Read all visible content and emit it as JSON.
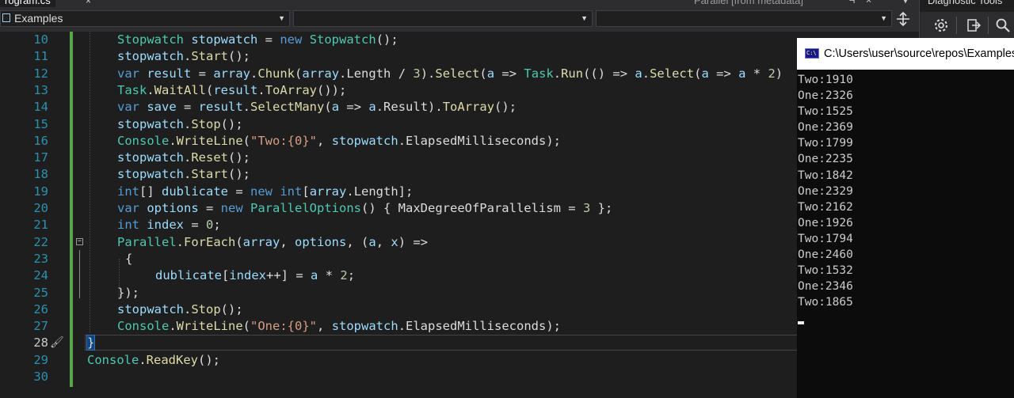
{
  "tabs": {
    "file_tab": "rogram.cs",
    "file_tab_close": "×",
    "metadata_tab": "Parallel [from metadata]",
    "metadata_pin": "⊣",
    "metadata_close": "×"
  },
  "navbar": {
    "project": "Examples",
    "type_member": "",
    "member": ""
  },
  "diagnostic": {
    "title": "Diagnostic Tools"
  },
  "editor": {
    "current_line": 28,
    "lines": [
      {
        "n": "10",
        "tokens": [
          [
            "ty",
            "Stopwatch"
          ],
          [
            "pn",
            " "
          ],
          [
            "vr",
            "stopwatch"
          ],
          [
            "pn",
            " = "
          ],
          [
            "kw",
            "new"
          ],
          [
            "pn",
            " "
          ],
          [
            "ty",
            "Stopwatch"
          ],
          [
            "pn",
            "();"
          ]
        ]
      },
      {
        "n": "11",
        "tokens": [
          [
            "vr",
            "stopwatch"
          ],
          [
            "pn",
            "."
          ],
          [
            "fn",
            "Start"
          ],
          [
            "pn",
            "();"
          ]
        ]
      },
      {
        "n": "12",
        "tokens": [
          [
            "kw",
            "var"
          ],
          [
            "pn",
            " "
          ],
          [
            "vr",
            "result"
          ],
          [
            "pn",
            " = "
          ],
          [
            "vr",
            "array"
          ],
          [
            "pn",
            "."
          ],
          [
            "fn",
            "Chunk"
          ],
          [
            "pn",
            "("
          ],
          [
            "vr",
            "array"
          ],
          [
            "pn",
            ".Length / "
          ],
          [
            "nm",
            "3"
          ],
          [
            "pn",
            ")."
          ],
          [
            "fn",
            "Select"
          ],
          [
            "pn",
            "("
          ],
          [
            "vr",
            "a"
          ],
          [
            "pn",
            " => "
          ],
          [
            "ty",
            "Task"
          ],
          [
            "pn",
            "."
          ],
          [
            "fn",
            "Run"
          ],
          [
            "pn",
            "(() => "
          ],
          [
            "vr",
            "a"
          ],
          [
            "pn",
            "."
          ],
          [
            "fn",
            "Select"
          ],
          [
            "pn",
            "("
          ],
          [
            "vr",
            "a"
          ],
          [
            "pn",
            " => "
          ],
          [
            "vr",
            "a"
          ],
          [
            "pn",
            " * "
          ],
          [
            "nm",
            "2"
          ],
          [
            "pn",
            ")"
          ]
        ]
      },
      {
        "n": "13",
        "tokens": [
          [
            "ty",
            "Task"
          ],
          [
            "pn",
            "."
          ],
          [
            "fn",
            "WaitAll"
          ],
          [
            "pn",
            "("
          ],
          [
            "vr",
            "result"
          ],
          [
            "pn",
            "."
          ],
          [
            "fn",
            "ToArray"
          ],
          [
            "pn",
            "());"
          ]
        ]
      },
      {
        "n": "14",
        "tokens": [
          [
            "kw",
            "var"
          ],
          [
            "pn",
            " "
          ],
          [
            "vr",
            "save"
          ],
          [
            "pn",
            " = "
          ],
          [
            "vr",
            "result"
          ],
          [
            "pn",
            "."
          ],
          [
            "fn",
            "SelectMany"
          ],
          [
            "pn",
            "("
          ],
          [
            "vr",
            "a"
          ],
          [
            "pn",
            " => "
          ],
          [
            "vr",
            "a"
          ],
          [
            "pn",
            ".Result)."
          ],
          [
            "fn",
            "ToArray"
          ],
          [
            "pn",
            "();"
          ]
        ]
      },
      {
        "n": "15",
        "tokens": [
          [
            "vr",
            "stopwatch"
          ],
          [
            "pn",
            "."
          ],
          [
            "fn",
            "Stop"
          ],
          [
            "pn",
            "();"
          ]
        ]
      },
      {
        "n": "16",
        "tokens": [
          [
            "ty",
            "Console"
          ],
          [
            "pn",
            "."
          ],
          [
            "fn",
            "WriteLine"
          ],
          [
            "pn",
            "("
          ],
          [
            "st",
            "\"Two:{0}\""
          ],
          [
            "pn",
            ", "
          ],
          [
            "vr",
            "stopwatch"
          ],
          [
            "pn",
            ".ElapsedMilliseconds);"
          ]
        ]
      },
      {
        "n": "17",
        "tokens": [
          [
            "vr",
            "stopwatch"
          ],
          [
            "pn",
            "."
          ],
          [
            "fn",
            "Reset"
          ],
          [
            "pn",
            "();"
          ]
        ]
      },
      {
        "n": "18",
        "tokens": [
          [
            "vr",
            "stopwatch"
          ],
          [
            "pn",
            "."
          ],
          [
            "fn",
            "Start"
          ],
          [
            "pn",
            "();"
          ]
        ]
      },
      {
        "n": "19",
        "tokens": [
          [
            "kw",
            "int"
          ],
          [
            "pn",
            "[] "
          ],
          [
            "vr",
            "dublicate"
          ],
          [
            "pn",
            " = "
          ],
          [
            "kw",
            "new"
          ],
          [
            "pn",
            " "
          ],
          [
            "kw",
            "int"
          ],
          [
            "pn",
            "["
          ],
          [
            "vr",
            "array"
          ],
          [
            "pn",
            ".Length];"
          ]
        ]
      },
      {
        "n": "20",
        "tokens": [
          [
            "kw",
            "var"
          ],
          [
            "pn",
            " "
          ],
          [
            "vr",
            "options"
          ],
          [
            "pn",
            " = "
          ],
          [
            "kw",
            "new"
          ],
          [
            "pn",
            " "
          ],
          [
            "ty",
            "ParallelOptions"
          ],
          [
            "pn",
            "() { MaxDegreeOfParallelism = "
          ],
          [
            "nm",
            "3"
          ],
          [
            "pn",
            " };"
          ]
        ]
      },
      {
        "n": "21",
        "tokens": [
          [
            "kw",
            "int"
          ],
          [
            "pn",
            " "
          ],
          [
            "vr",
            "index"
          ],
          [
            "pn",
            " = "
          ],
          [
            "nm",
            "0"
          ],
          [
            "pn",
            ";"
          ]
        ]
      },
      {
        "n": "22",
        "tokens": [
          [
            "ty",
            "Parallel"
          ],
          [
            "pn",
            "."
          ],
          [
            "fn",
            "ForEach"
          ],
          [
            "pn",
            "("
          ],
          [
            "vr",
            "array"
          ],
          [
            "pn",
            ", "
          ],
          [
            "vr",
            "options"
          ],
          [
            "pn",
            ", ("
          ],
          [
            "vr",
            "a"
          ],
          [
            "pn",
            ", "
          ],
          [
            "vr",
            "x"
          ],
          [
            "pn",
            ") =>"
          ]
        ]
      },
      {
        "n": "23",
        "tokens": [
          [
            "pn",
            "{"
          ]
        ]
      },
      {
        "n": "24",
        "tokens": [
          [
            "vr",
            "dublicate"
          ],
          [
            "pn",
            "["
          ],
          [
            "vr",
            "index"
          ],
          [
            "pn",
            "++] = "
          ],
          [
            "vr",
            "a"
          ],
          [
            "pn",
            " * "
          ],
          [
            "nm",
            "2"
          ],
          [
            "pn",
            ";"
          ]
        ]
      },
      {
        "n": "25",
        "tokens": [
          [
            "pn",
            "});"
          ]
        ]
      },
      {
        "n": "26",
        "tokens": [
          [
            "vr",
            "stopwatch"
          ],
          [
            "pn",
            "."
          ],
          [
            "fn",
            "Stop"
          ],
          [
            "pn",
            "();"
          ]
        ]
      },
      {
        "n": "27",
        "tokens": [
          [
            "ty",
            "Console"
          ],
          [
            "pn",
            "."
          ],
          [
            "fn",
            "WriteLine"
          ],
          [
            "pn",
            "("
          ],
          [
            "st",
            "\"One:{0}\""
          ],
          [
            "pn",
            ", "
          ],
          [
            "vr",
            "stopwatch"
          ],
          [
            "pn",
            ".ElapsedMilliseconds);"
          ]
        ]
      },
      {
        "n": "28",
        "tokens": [
          [
            "hl",
            "}"
          ]
        ]
      },
      {
        "n": "29",
        "tokens": [
          [
            "ty",
            "Console"
          ],
          [
            "pn",
            "."
          ],
          [
            "fn",
            "ReadKey"
          ],
          [
            "pn",
            "();"
          ]
        ]
      },
      {
        "n": "30",
        "tokens": []
      }
    ]
  },
  "console": {
    "title": "C:\\Users\\user\\source\\repos\\Examples",
    "icon_text": "C:\\",
    "output": [
      "Two:1910",
      "One:2326",
      "Two:1525",
      "One:2369",
      "Two:1799",
      "One:2235",
      "Two:1842",
      "One:2329",
      "Two:2162",
      "One:1926",
      "Two:1794",
      "One:2460",
      "Two:1532",
      "One:2346",
      "Two:1865"
    ]
  },
  "icons": {
    "settings": "gear-icon",
    "export": "export-icon",
    "zoom": "zoom-icon",
    "split": "split-window-icon",
    "brush": "brush-icon",
    "fold": "collapse-icon"
  }
}
